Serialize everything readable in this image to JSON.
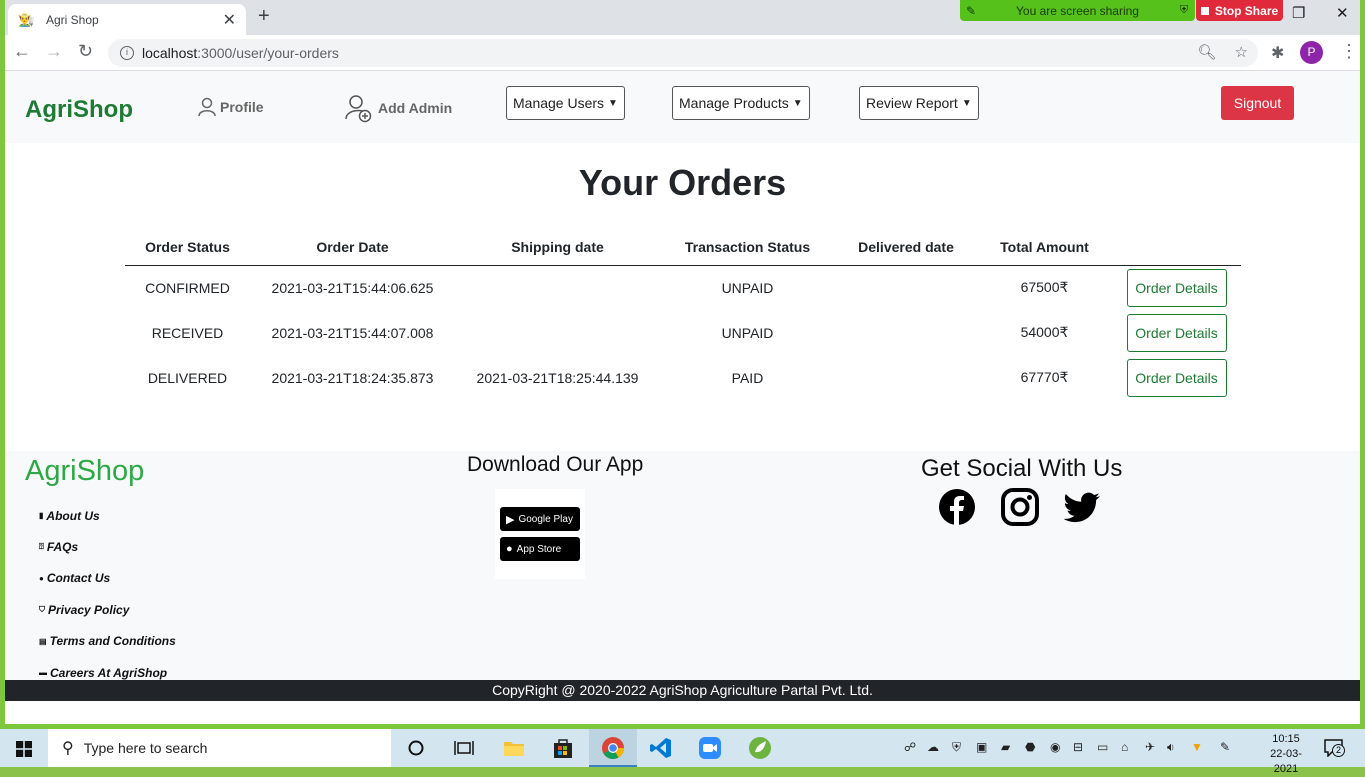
{
  "browser": {
    "tab_title": "Agri Shop",
    "url_host": "localhost",
    "url_path": ":3000/user/your-orders",
    "share_text": "You are screen sharing",
    "stop_share_label": "Stop Share",
    "profile_initial": "P"
  },
  "navbar": {
    "brand": "AgriShop",
    "profile_label": "Profile",
    "add_admin_label": "Add Admin",
    "manage_users_label": "Manage Users",
    "manage_products_label": "Manage Products",
    "review_report_label": "Review Report",
    "signout_label": "Signout"
  },
  "orders": {
    "title": "Your Orders",
    "columns": [
      "Order Status",
      "Order Date",
      "Shipping date",
      "Transaction Status",
      "Delivered date",
      "Total Amount",
      ""
    ],
    "rows": [
      {
        "status": "CONFIRMED",
        "order_date": "2021-03-21T15:44:06.625",
        "shipping_date": "",
        "transaction": "UNPAID",
        "delivered_date": "",
        "amount": "67500₹",
        "action": "Order Details"
      },
      {
        "status": "RECEIVED",
        "order_date": "2021-03-21T15:44:07.008",
        "shipping_date": "",
        "transaction": "UNPAID",
        "delivered_date": "",
        "amount": "54000₹",
        "action": "Order Details"
      },
      {
        "status": "DELIVERED",
        "order_date": "2021-03-21T18:24:35.873",
        "shipping_date": "2021-03-21T18:25:44.139",
        "transaction": "PAID",
        "delivered_date": "",
        "amount": "67770₹",
        "action": "Order Details"
      }
    ]
  },
  "footer": {
    "brand": "AgriShop",
    "links": [
      "About Us",
      "FAQs",
      "Contact Us",
      "Privacy Policy",
      "Terms and Conditions",
      "Careers At AgriShop"
    ],
    "app_title": "Download Our App",
    "google_play_label": "Google Play",
    "app_store_label": "App Store",
    "social_title": "Get Social With Us",
    "copyright": "CopyRight @ 2020-2022 AgriShop Agriculture Partal Pvt. Ltd."
  },
  "taskbar": {
    "search_placeholder": "Type here to search",
    "time": "10:15",
    "date": "22-03-2021",
    "notification_count": "2"
  }
}
